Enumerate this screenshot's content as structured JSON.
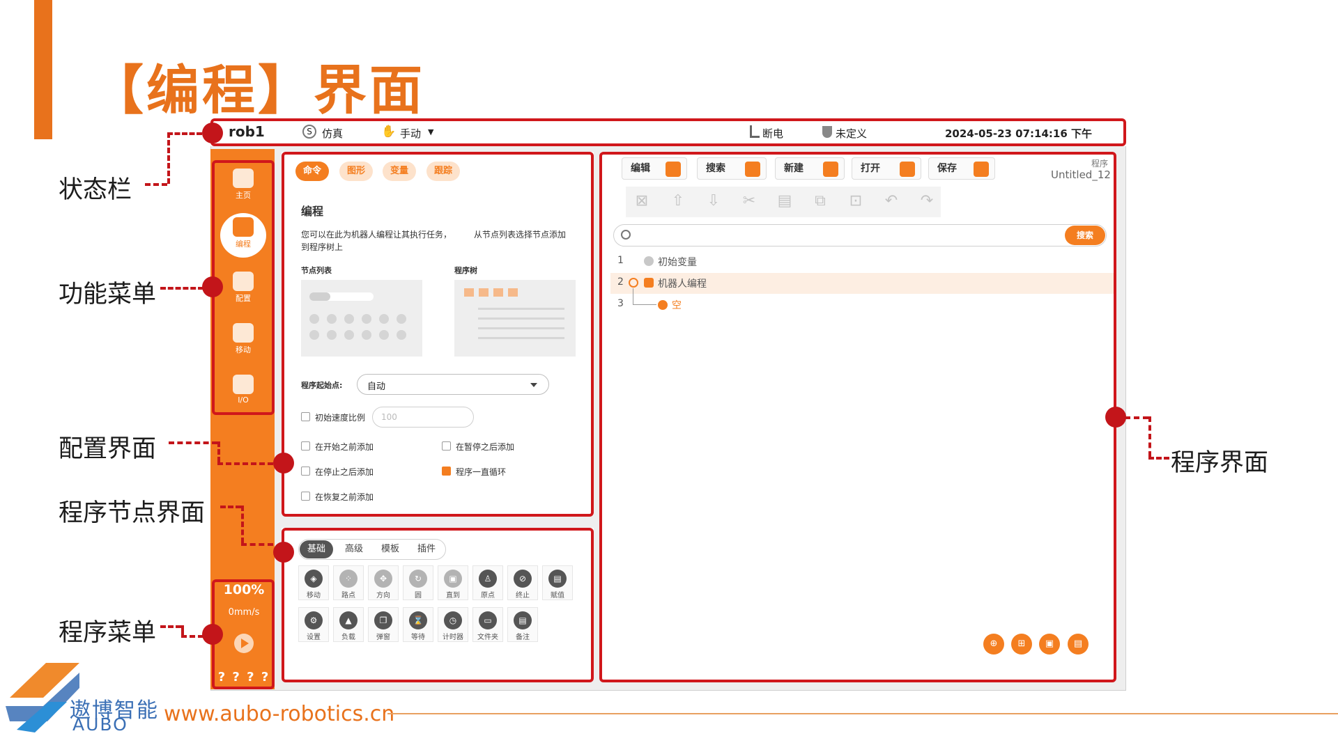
{
  "slide": {
    "title": "【编程】界面",
    "callouts": {
      "status_bar": "状态栏",
      "function_menu": "功能菜单",
      "config_ui": "配置界面",
      "node_ui": "程序节点界面",
      "program_menu": "程序菜单",
      "program_ui": "程序界面"
    },
    "footer": {
      "brand_cn": "遨博智能",
      "brand_en": "AUBO",
      "url": "www.aubo-robotics.cn"
    }
  },
  "statusbar": {
    "robot": "rob1",
    "sim_badge": "S",
    "sim": "仿真",
    "mode": "手动",
    "mode_caret": "▼",
    "power": "断电",
    "safety": "未定义",
    "datetime": "2024-05-23 07:14:16 下午"
  },
  "sidebar": {
    "items": [
      {
        "label": "主页",
        "icon": "home-icon"
      },
      {
        "label": "编程",
        "icon": "code-icon"
      },
      {
        "label": "配置",
        "icon": "config-icon"
      },
      {
        "label": "移动",
        "icon": "move-icon"
      },
      {
        "label": "I/O",
        "icon": "io-icon"
      }
    ],
    "speed": "100%",
    "velocity": "0mm/s",
    "bottom": "? ? ? ?"
  },
  "config": {
    "tabs": [
      "命令",
      "图形",
      "变量",
      "跟踪"
    ],
    "heading": "编程",
    "desc1": "您可以在此为机器人编程让其执行任务，",
    "desc1b": "从节点列表选择节点添加",
    "desc2": "到程序树上",
    "node_list": "节点列表",
    "program_tree": "程序树",
    "start_label": "程序起始点:",
    "start_value": "自动",
    "init_speed": "初始速度比例",
    "init_speed_placeholder": "100",
    "opt_before_start": "在开始之前添加",
    "opt_after_pause": "在暂停之后添加",
    "opt_after_stop": "在停止之后添加",
    "opt_loop": "程序一直循环",
    "opt_before_resume": "在恢复之前添加"
  },
  "nodes": {
    "tabs": [
      "基础",
      "高级",
      "模板",
      "插件"
    ],
    "row1": [
      "移动",
      "路点",
      "方向",
      "圆",
      "直到",
      "原点",
      "终止",
      "赋值"
    ],
    "row2": [
      "设置",
      "负载",
      "弹窗",
      "等待",
      "计时器",
      "文件夹",
      "备注"
    ]
  },
  "program": {
    "toolbar": [
      "编辑",
      "搜索",
      "新建",
      "打开",
      "保存"
    ],
    "meta_label": "程序",
    "name": "Untitled_12",
    "search_btn": "搜索",
    "tree": [
      {
        "num": "1",
        "text": "初始变量"
      },
      {
        "num": "2",
        "text": "机器人编程"
      },
      {
        "num": "3",
        "text": "空"
      }
    ]
  },
  "colors": {
    "accent": "#f47e20",
    "callout_red": "#c3151a",
    "title_orange": "#e8721c"
  }
}
